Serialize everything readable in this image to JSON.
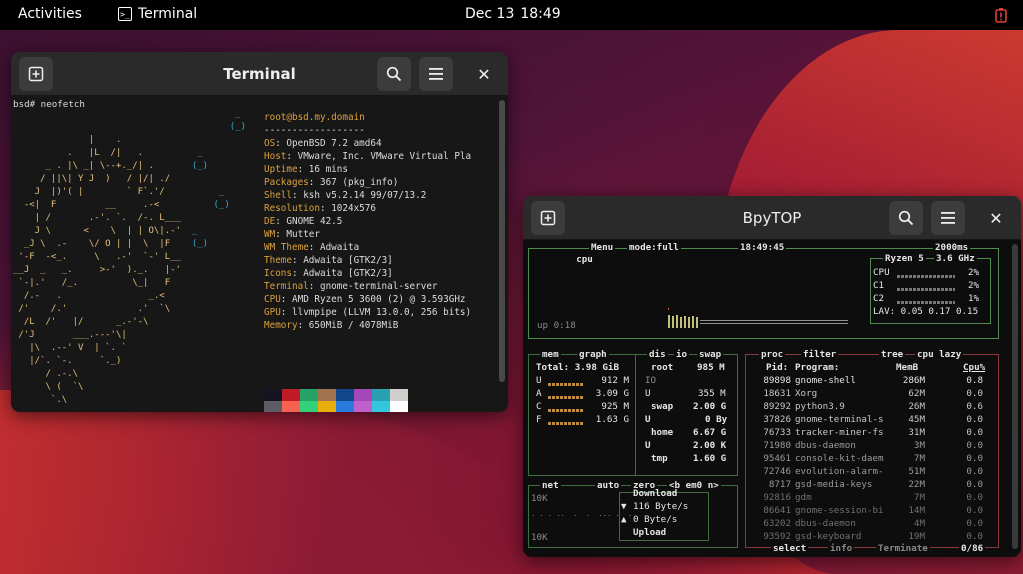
{
  "topbar": {
    "activities": "Activities",
    "app_name": "Terminal",
    "date": "Dec 13",
    "time": "18:49"
  },
  "terminal": {
    "title": "Terminal",
    "prompt": "bsd# neofetch",
    "user_host": "root@bsd.my.domain",
    "separator": "------------------",
    "info": [
      {
        "k": "OS",
        "v": "OpenBSD 7.2 amd64"
      },
      {
        "k": "Host",
        "v": "VMware, Inc. VMware Virtual Pla"
      },
      {
        "k": "Uptime",
        "v": "16 mins"
      },
      {
        "k": "Packages",
        "v": "367 (pkg_info)"
      },
      {
        "k": "Shell",
        "v": "ksh v5.2.14 99/07/13.2"
      },
      {
        "k": "Resolution",
        "v": "1024x576"
      },
      {
        "k": "DE",
        "v": "GNOME 42.5"
      },
      {
        "k": "WM",
        "v": "Mutter"
      },
      {
        "k": "WM Theme",
        "v": "Adwaita"
      },
      {
        "k": "Theme",
        "v": "Adwaita [GTK2/3]"
      },
      {
        "k": "Icons",
        "v": "Adwaita [GTK2/3]"
      },
      {
        "k": "Terminal",
        "v": "gnome-terminal-server"
      },
      {
        "k": "CPU",
        "v": "AMD Ryzen 5 3600 (2) @ 3.593GHz"
      },
      {
        "k": "GPU",
        "v": "llvmpipe (LLVM 13.0.0, 256 bits)"
      },
      {
        "k": "Memory",
        "v": "650MiB / 4078MiB"
      }
    ],
    "palette_top": [
      "#171421",
      "#c01c28",
      "#26a269",
      "#a2734c",
      "#12488b",
      "#a347ba",
      "#2aa1b3",
      "#d0cfcc"
    ],
    "palette_bottom": [
      "#5e5c64",
      "#f66151",
      "#33d17a",
      "#e9ad0c",
      "#2a7bde",
      "#c061cb",
      "#33c7de",
      "#ffffff"
    ]
  },
  "bpytop": {
    "title": "BpyTOP",
    "cpu": {
      "tab": "cpu",
      "menu": "Menu",
      "mode": "mode:full",
      "clock": "18:49:45",
      "interval": "2000ms",
      "model": "Ryzen 5",
      "freq": "3.6 GHz",
      "uptime": "up 0:18",
      "rows": [
        {
          "name": "CPU",
          "pct": "2%"
        },
        {
          "name": "C1",
          "pct": "2%"
        },
        {
          "name": "C2",
          "pct": "1%"
        }
      ],
      "lav": "LAV: 0.05 0.17 0.15"
    },
    "mem": {
      "tab": "mem",
      "graph": "graph",
      "total": "Total: 3.98 GiB",
      "rows": [
        {
          "k": "U",
          "v": "912 M"
        },
        {
          "k": "A",
          "v": "3.09 G"
        },
        {
          "k": "C",
          "v": "925 M"
        },
        {
          "k": "F",
          "v": "1.63 G"
        }
      ]
    },
    "disks": {
      "tab": "dis",
      "io": "io",
      "swap_tab": "swap",
      "root_label": "root",
      "root_size": "985 M",
      "io_label": "IO",
      "root_used_k": "U",
      "root_used": "355 M",
      "swap_label": "swap",
      "swap_size": "2.00 G",
      "swap_used_k": "U",
      "swap_used": "0 By",
      "home_label": "home",
      "home_size": "6.67 G",
      "home_used_k": "U",
      "home_used": "2.00 K",
      "tmp_label": "tmp",
      "tmp_size": "1.60 G"
    },
    "net": {
      "tab": "net",
      "auto": "auto",
      "zero": "zero",
      "iface": "<b em0 n>",
      "scale_top": "10K",
      "scale_bottom": "10K",
      "download_label": "Download",
      "download_rate": "116 Byte/s",
      "upload_rate": "0 Byte/s",
      "upload_label": "Upload"
    },
    "proc": {
      "tab": "proc",
      "filter": "filter",
      "tree": "tree",
      "sort": "cpu lazy",
      "headers": {
        "pid": "Pid:",
        "program": "Program:",
        "mem": "MemB",
        "cpu": "Cpu%"
      },
      "rows": [
        {
          "pid": "89898",
          "program": "gnome-shell",
          "mem": "286M",
          "cpu": "0.8"
        },
        {
          "pid": "18631",
          "program": "Xorg",
          "mem": "62M",
          "cpu": "0.0"
        },
        {
          "pid": "89292",
          "program": "python3.9",
          "mem": "26M",
          "cpu": "0.6"
        },
        {
          "pid": "37826",
          "program": "gnome-terminal-s",
          "mem": "45M",
          "cpu": "0.0"
        },
        {
          "pid": "76733",
          "program": "tracker-miner-fs",
          "mem": "31M",
          "cpu": "0.0"
        },
        {
          "pid": "71980",
          "program": "dbus-daemon",
          "mem": "3M",
          "cpu": "0.0"
        },
        {
          "pid": "95461",
          "program": "console-kit-daem",
          "mem": "7M",
          "cpu": "0.0"
        },
        {
          "pid": "72746",
          "program": "evolution-alarm-",
          "mem": "51M",
          "cpu": "0.0"
        },
        {
          "pid": "8717",
          "program": "gsd-media-keys",
          "mem": "22M",
          "cpu": "0.0"
        },
        {
          "pid": "92816",
          "program": "gdm",
          "mem": "7M",
          "cpu": "0.0"
        },
        {
          "pid": "86641",
          "program": "gnome-session-bi",
          "mem": "14M",
          "cpu": "0.0"
        },
        {
          "pid": "63202",
          "program": "dbus-daemon",
          "mem": "4M",
          "cpu": "0.0"
        },
        {
          "pid": "93592",
          "program": "gsd-keyboard",
          "mem": "19M",
          "cpu": "0.0"
        }
      ],
      "select": "select",
      "info": "info",
      "terminate": "Terminate",
      "count": "0/86"
    }
  }
}
